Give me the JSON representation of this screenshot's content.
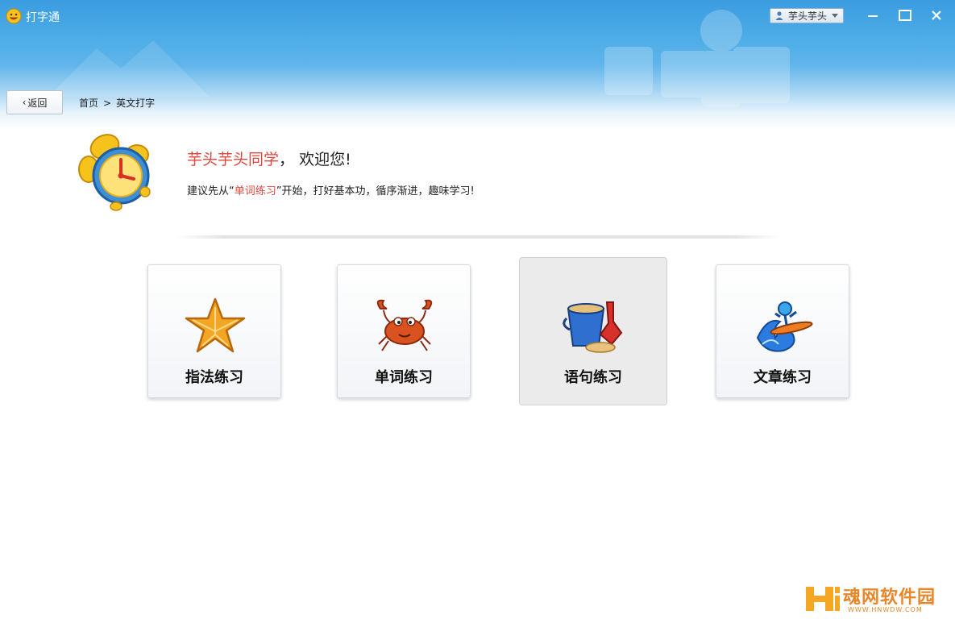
{
  "app": {
    "title": "打字通"
  },
  "user_menu": {
    "username": "芋头芋头"
  },
  "window_controls": {
    "minimize": "minimize",
    "maximize": "maximize",
    "close": "close"
  },
  "nav": {
    "back_label": "返回",
    "breadcrumb": [
      {
        "label": "首页"
      },
      {
        "label": "英文打字"
      }
    ],
    "separator": ">"
  },
  "welcome": {
    "name": "芋头芋头同学",
    "comma": "，",
    "greeting": "欢迎您!",
    "tip_prefix": "建议先从“",
    "tip_highlight": "单词练习",
    "tip_suffix": "”开始，打好基本功，循序渐进，趣味学习!"
  },
  "cards": [
    {
      "label": "指法练习",
      "icon": "starfish-icon"
    },
    {
      "label": "单词练习",
      "icon": "crab-icon"
    },
    {
      "label": "语句练习",
      "icon": "sand-bucket-icon",
      "selected": true
    },
    {
      "label": "文章练习",
      "icon": "surfing-icon"
    }
  ],
  "watermark": {
    "text": "魂网软件园",
    "url": "WWW.HNWDW.COM"
  },
  "colors": {
    "header": "#3a9ce0",
    "highlight": "#e0463e",
    "watermark": "#e8862a"
  }
}
